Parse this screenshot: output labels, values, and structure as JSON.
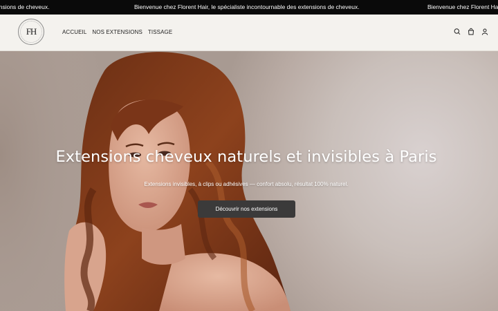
{
  "announcement": {
    "message_start": "ensions de cheveux.",
    "message": "Bienvenue chez Florent Hair, le spécialiste incontournable des extensions de cheveux.",
    "message_end": "Bienvenue chez Florent Hair,"
  },
  "header": {
    "logo_text": "FH",
    "nav": [
      "ACCUEIL",
      "NOS EXTENSIONS",
      "TISSAGE"
    ]
  },
  "icons": [
    "search-icon",
    "cart-icon",
    "account-icon"
  ],
  "hero": {
    "title": "Extensions cheveux naturels et invisibles à Paris",
    "subtitle": "Extensions invisibles, à clips ou adhésives — confort absolu, résultat 100% naturel.",
    "cta": "Découvrir nos extensions"
  },
  "colors": {
    "announcement_bg": "#0a0a0a",
    "header_bg": "#f4f2ee",
    "cta_bg": "#3b3a3a",
    "hair": "#8a3f1c"
  }
}
